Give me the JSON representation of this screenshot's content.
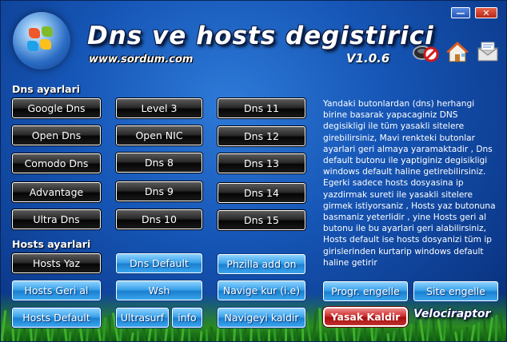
{
  "window": {
    "title": "Dns ve hosts degistirici",
    "url": "www.sordum.com",
    "version": "V1.0.6",
    "minimize_glyph": "—",
    "close_glyph": "✕"
  },
  "toolbar_icons": [
    "block-icon",
    "home-icon",
    "mail-icon"
  ],
  "dns": {
    "section_label": "Dns ayarlari",
    "col1": [
      "Google Dns",
      "Open Dns",
      "Comodo Dns",
      "Advantage",
      "Ultra Dns"
    ],
    "col2": [
      "Level 3",
      "Open NIC",
      "Dns 8",
      "Dns 9",
      "Dns 10"
    ],
    "col3": [
      "Dns 11",
      "Dns 12",
      "Dns 13",
      "Dns 14",
      "Dns 15"
    ]
  },
  "hosts": {
    "section_label": "Hosts ayarlari",
    "hosts_yaz": "Hosts Yaz",
    "dns_default": "Dns Default",
    "phzilla": "Phzilla add on",
    "hosts_geri_al": "Hosts Geri al",
    "wsh": "Wsh",
    "navige_kur": "Navige kur (i.e)",
    "hosts_default": "Hosts Default",
    "ultrasurf": "Ultrasurf",
    "info": "info",
    "navigeyi_kaldir": "Navigeyi kaldir"
  },
  "right_panel": {
    "description": "Yandaki butonlardan (dns) herhangi birine basarak yapacaginiz DNS degisikligi ile tüm yasakli sitelere girebilirsiniz, Mavi renkteki butonlar ayarlari geri almaya yaramaktadir , Dns default butonu ile yaptiginiz degisikligi windows default haline getirebilirsiniz. Egerki sadece hosts dosyasina ip yazdirmak sureti ile yasakli sitelere girmek istiyorsaniz , Hosts yaz butonuna basmaniz yeterlidir , yine Hosts geri al butonu ile bu ayarlari geri alabilirsiniz, Hosts default ise hosts dosyanizi tüm ip girislerinden kurtarip windows default haline getirir",
    "progr_engelle": "Progr. engelle",
    "site_engelle": "Site engelle",
    "yasak_kaldir": "Yasak Kaldir",
    "brand": "Velociraptor"
  }
}
